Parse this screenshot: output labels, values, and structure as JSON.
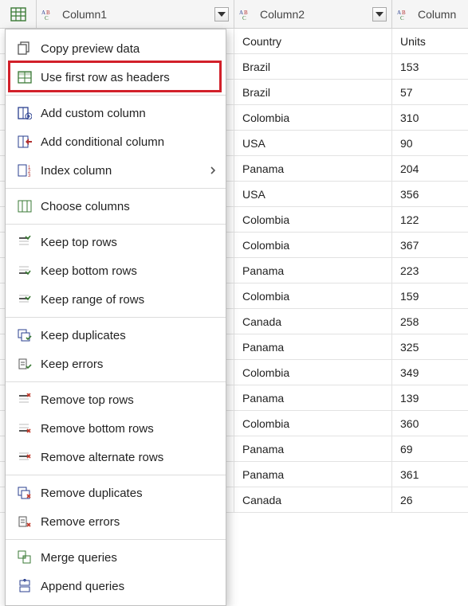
{
  "columns": {
    "col1": "Column1",
    "col2": "Column2",
    "col3": "Column"
  },
  "rows": [
    {
      "c2": "Country",
      "c3": "Units"
    },
    {
      "c2": "Brazil",
      "c3": "153"
    },
    {
      "c2": "Brazil",
      "c3": "57"
    },
    {
      "c2": "Colombia",
      "c3": "310"
    },
    {
      "c2": "USA",
      "c3": "90"
    },
    {
      "c2": "Panama",
      "c3": "204"
    },
    {
      "c2": "USA",
      "c3": "356"
    },
    {
      "c2": "Colombia",
      "c3": "122"
    },
    {
      "c2": "Colombia",
      "c3": "367"
    },
    {
      "c2": "Panama",
      "c3": "223"
    },
    {
      "c2": "Colombia",
      "c3": "159"
    },
    {
      "c2": "Canada",
      "c3": "258"
    },
    {
      "c2": "Panama",
      "c3": "325"
    },
    {
      "c2": "Colombia",
      "c3": "349"
    },
    {
      "c2": "Panama",
      "c3": "139"
    },
    {
      "c2": "Colombia",
      "c3": "360"
    },
    {
      "c2": "Panama",
      "c3": "69"
    },
    {
      "c2": "Panama",
      "c3": "361"
    },
    {
      "c2": "Canada",
      "c3": "26"
    }
  ],
  "menu": {
    "copy_preview": "Copy preview data",
    "use_first_row": "Use first row as headers",
    "add_custom": "Add custom column",
    "add_conditional": "Add conditional column",
    "index_column": "Index column",
    "choose_columns": "Choose columns",
    "keep_top": "Keep top rows",
    "keep_bottom": "Keep bottom rows",
    "keep_range": "Keep range of rows",
    "keep_dupes": "Keep duplicates",
    "keep_errors": "Keep errors",
    "remove_top": "Remove top rows",
    "remove_bottom": "Remove bottom rows",
    "remove_alternate": "Remove alternate rows",
    "remove_dupes": "Remove duplicates",
    "remove_errors": "Remove errors",
    "merge": "Merge queries",
    "append": "Append queries"
  }
}
